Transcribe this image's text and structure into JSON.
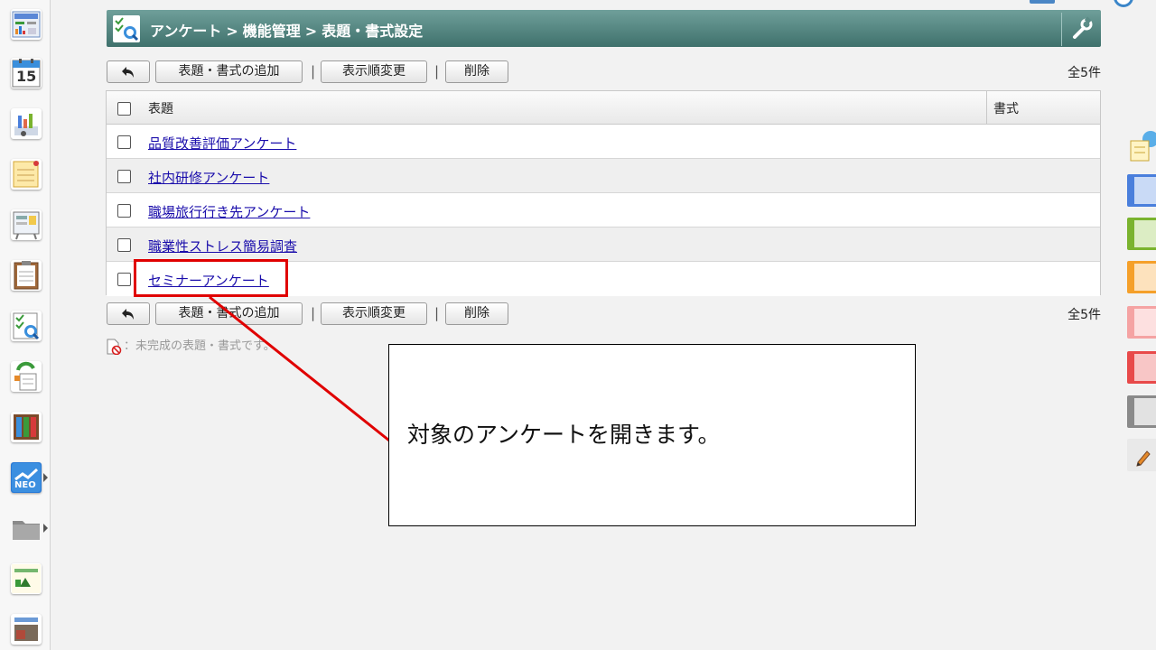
{
  "header": {
    "breadcrumb": [
      "アンケート",
      "機能管理",
      "表題・書式設定"
    ],
    "separator": ">"
  },
  "toolbar": {
    "add_label": "表題・書式の追加",
    "order_label": "表示順変更",
    "delete_label": "削除",
    "separator": "|",
    "count_label": "全5件"
  },
  "table": {
    "headers": {
      "title": "表題",
      "format": "書式"
    },
    "rows": [
      {
        "title": "品質改善評価アンケート",
        "format": ""
      },
      {
        "title": "社内研修アンケート",
        "format": ""
      },
      {
        "title": "職場旅行行き先アンケート",
        "format": ""
      },
      {
        "title": "職業性ストレス簡易調査",
        "format": ""
      },
      {
        "title": "セミナーアンケート",
        "format": ""
      }
    ]
  },
  "legend": {
    "text": "：未完成の表題・書式です。"
  },
  "callout": {
    "text": "対象のアンケートを開きます。"
  },
  "sidebar": {
    "calendar_day": "15",
    "neo_label": "NEO"
  },
  "colors": {
    "header_start": "#6f9f9a",
    "header_end": "#3f716c",
    "link": "#1a0dab",
    "highlight": "#e00000",
    "right_tabs": [
      "#4a7fdc",
      "#7ab32e",
      "#f5a02a",
      "#f5a3a3",
      "#e84a4a",
      "#8a8a8a"
    ]
  }
}
